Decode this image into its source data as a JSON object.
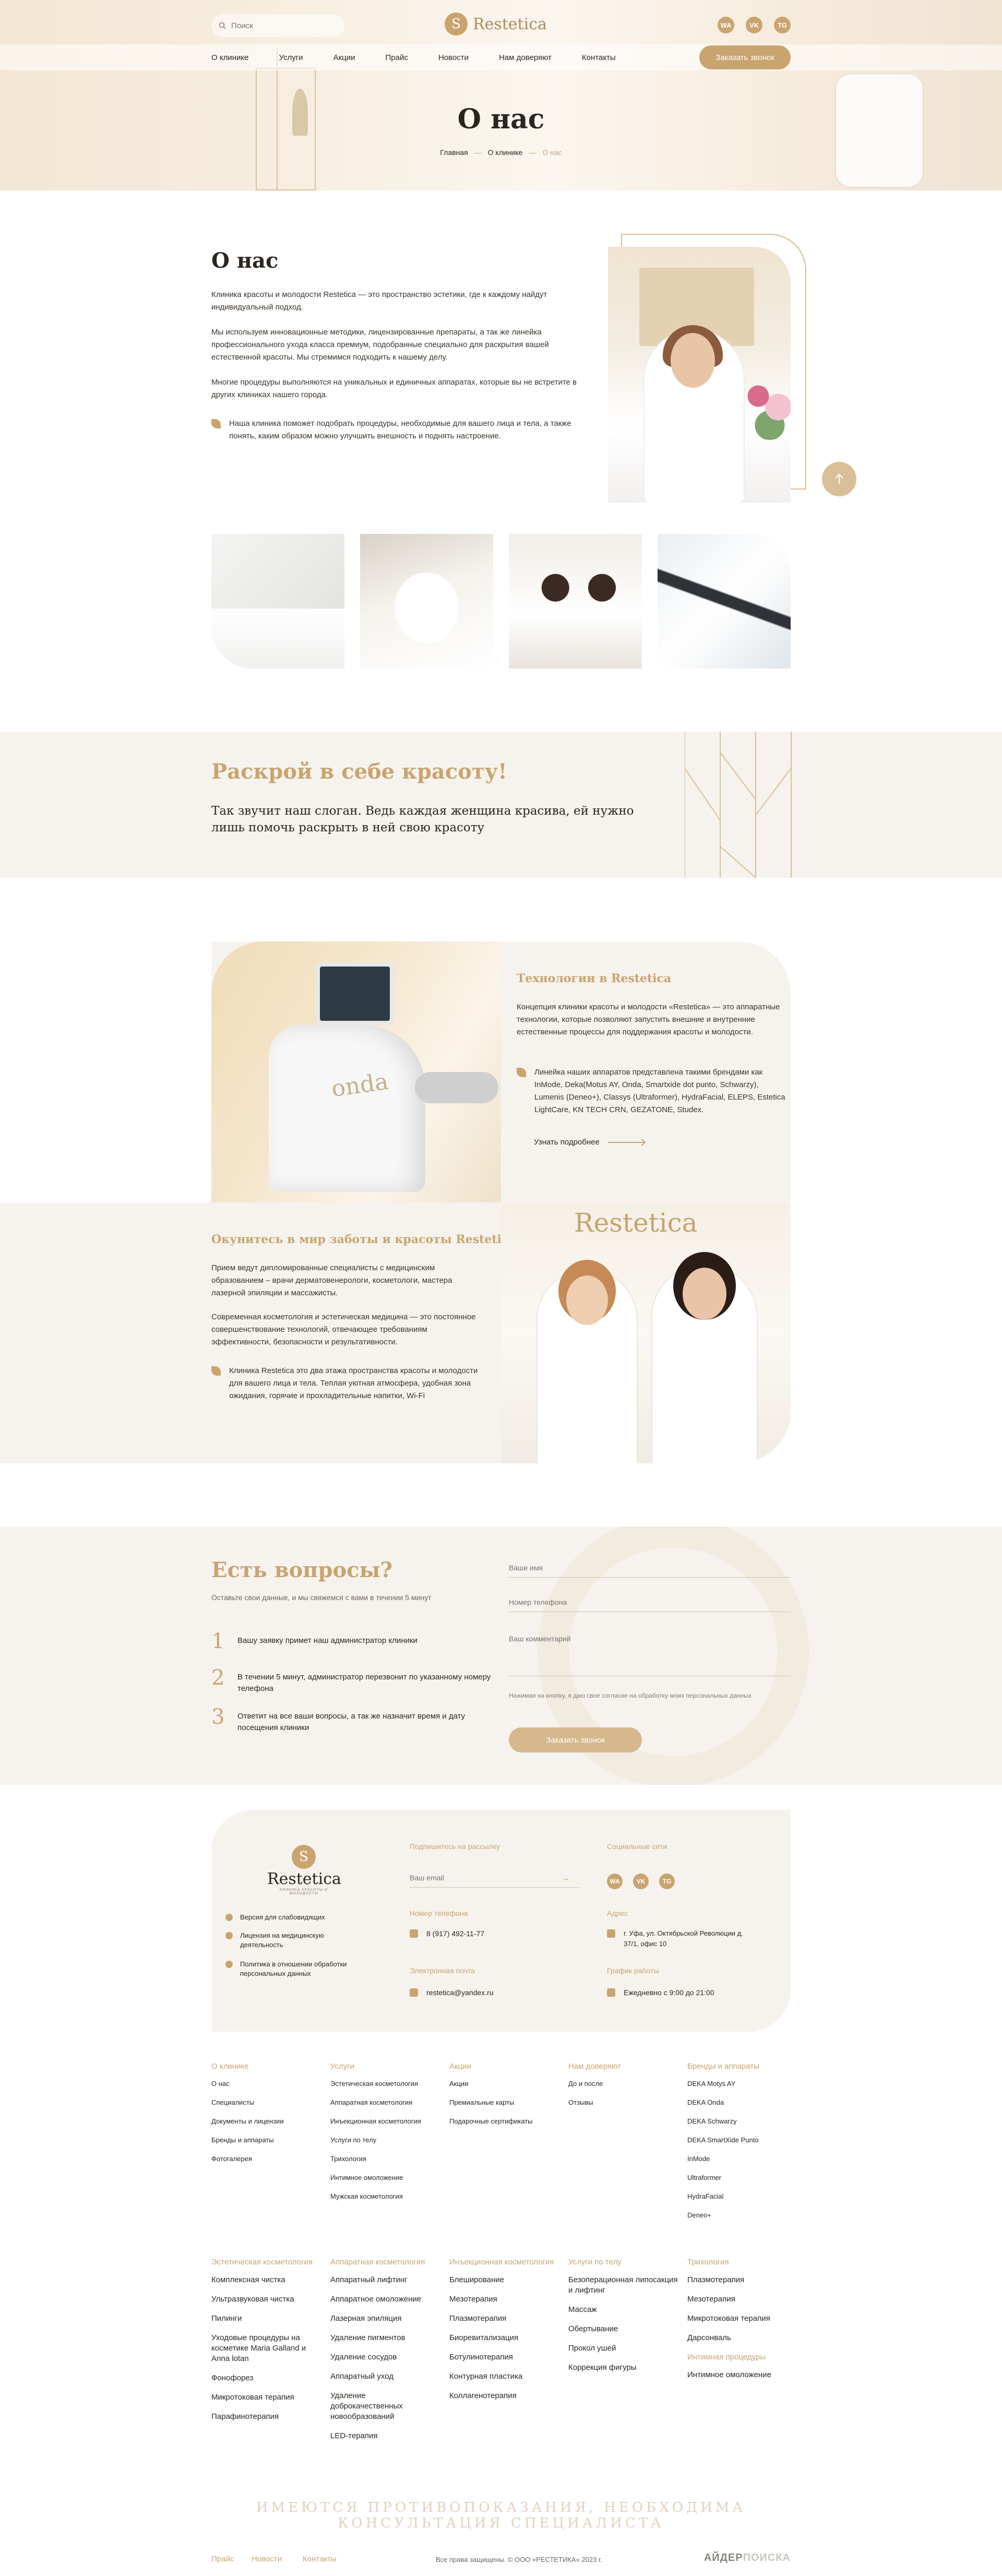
{
  "header": {
    "search_placeholder": "Поиск",
    "logo_text": "Restetica",
    "socials": [
      "WA",
      "VK",
      "TG"
    ],
    "nav": [
      "О клинике",
      "Услуги",
      "Акции",
      "Прайс",
      "Новости",
      "Нам доверяют",
      "Контакты"
    ],
    "call_button": "Заказать звонок"
  },
  "hero": {
    "title": "О нас",
    "breadcrumb": {
      "home": "Главная",
      "clinic": "О клинике",
      "current": "О нас"
    }
  },
  "about": {
    "title": "О нас",
    "p1": "Клиника красоты и молодости Restetica — это пространство эстетики, где к каждому найдут индивидуальный подход.",
    "p2": "Мы используем инновационные методики, лицензированные препараты, а так же линейка профессионального ухода класса премиум, подобранные специально для раскрытия вашей естественной красоты. Мы стремимся подходить к нашему делу.",
    "p3": "Многие процедуры выполняются на уникальных и единичных аппаратах, которые вы не встретите в других клиниках нашего города.",
    "bullet": "Наша клиника поможет подобрать процедуры, необходимые для вашего лица и тела, а также понять, каким образом можно улучшить внешность и поднять настроение."
  },
  "slogan": {
    "title": "Раскрой в себе красоту!",
    "text": "Так звучит наш слоган. Ведь каждая женщина красива, ей нужно лишь помочь раскрыть в ней свою красоту"
  },
  "tech": {
    "title": "Технологии в Restetica",
    "p1": "Концепция клиники красоты и молодости «Restetica» — это аппаратные технологии, которые позволяют запустить внешние и внутренние естественные процессы для поддержания красоты и молодости.",
    "bullet": "Линейка наших аппаратов представлена такими брендами как InMode, Deka(Motus AY, Onda, Smartxide dot punto, Schwarzy), Lumenis (Deneo+), Classys (Ultraformer), HydraFacial, ELEPS, Estetica LightCare, KN TECH CRN, GEZATONE, Studex.",
    "more": "Узнать подробнее"
  },
  "care": {
    "title": "Окунитесь в мир заботы и красоты Restetica!",
    "p1": "Прием ведут дипломированные специалисты с медицинским образованием – врачи дерматовенерологи, косметологи, мастера лазерной эпиляции и массажисты.",
    "p2": "Современная косметология и эстетическая медицина — это постоянное совершенствование технологий, отвечающее требованиям эффективности, безопасности и результативности.",
    "bullet": "Клиника Restetica это два этажа пространства красоты и молодости для вашего лица и тела. Теплая уютная атмосфера, удобная зона ожидания, горячие и прохладительные напитки, Wi-Fi",
    "image_sign": "Restetica"
  },
  "questions": {
    "title": "Есть вопросы?",
    "subtitle": "Оставьте свои данные, и мы свяжемся с вами в течении 5 минут",
    "steps": [
      {
        "n": "1",
        "text": "Вашу заявку примет наш администратор клиники"
      },
      {
        "n": "2",
        "text": "В течении 5 минут, администратор перезвонит по указанному номеру телефона"
      },
      {
        "n": "3",
        "text": "Ответит на все ваши вопросы, а так же назначит время и дату посещения клиники"
      }
    ],
    "name_placeholder": "Ваше имя",
    "phone_placeholder": "Номер телефона",
    "comment_placeholder": "Ваш комментарий",
    "consent": "Нажимая на кнопку, я даю свое согласие на обработку моих персональных данных",
    "button": "Заказать звонок"
  },
  "footer_card": {
    "logo": "Restetica",
    "logo_sub": "КЛИНИКА КРАСОТЫ И МОЛОДОСТИ",
    "links": [
      "Версия для слабовидящих",
      "Лицензия на медицинскую деятельность",
      "Политика в отношении обработки персональных данных"
    ],
    "subscribe_label": "Подпишитесь на рассылку",
    "email_placeholder": "Ваш email",
    "phone_label": "Номер телефона",
    "phone": "8 (917) 492-11-77",
    "mail_label": "Электронная почта",
    "mail": "restetica@yandex.ru",
    "social_label": "Социальные сети",
    "address_label": "Адрес",
    "address": "г. Уфа, ул. Октябрьской Революции д. 37/1, офис 10",
    "hours_label": "График работы",
    "hours": "Ежедневно с 9:00 до 21:00"
  },
  "sitemap": {
    "row1": [
      {
        "head": "О клинике",
        "items": [
          "О нас",
          "Специалисты",
          "Документы и лицензии",
          "Бренды и аппараты",
          "Фотогалерея"
        ]
      },
      {
        "head": "Услуги",
        "items": [
          "Эстетическая косметология",
          "Аппаратная косметология",
          "Инъекционная косметология",
          "Услуги по телу",
          "Трихология",
          "Интимное омоложение",
          "Мужская косметология"
        ]
      },
      {
        "head": "Акции",
        "items": [
          "Акции",
          "Премиальные карты",
          "Подарочные сертификаты"
        ]
      },
      {
        "head": "Нам доверяют",
        "items": [
          "До и после",
          "Отзывы"
        ]
      },
      {
        "head": "Бренды и аппараты",
        "items": [
          "DEKA Motys AY",
          "DEKA Onda",
          "DEKA Schwarzy",
          "DEKA SmartXide Punto",
          "InMode",
          "Ultraformer",
          "HydraFacial",
          "Deneo+"
        ]
      }
    ],
    "row2": [
      {
        "head": "Эстетическая косметология",
        "items": [
          "Комплексная чистка",
          "Ультразвуковая чистка",
          "Пилинги",
          "Уходовые процедуры на косметике Maria Galland и Anna lotan",
          "Фонофорез",
          "Микротоковая терапия",
          "Парафинотерапия"
        ]
      },
      {
        "head": "Аппаратная косметология",
        "items": [
          "Аппаратный лифтинг",
          "Аппаратное омоложение",
          "Лазерная эпиляция",
          "Удаление пигментов",
          "Удаление сосудов",
          "Аппаратный уход",
          "Удаление доброкачественных новообразований",
          "LED-терапия"
        ]
      },
      {
        "head": "Инъекционная косметология",
        "items": [
          "Блеширование",
          "Мезотерапия",
          "Плазмотерапия",
          "Биоревитализация",
          "Ботулинотерапия",
          "Контурная пластика",
          "Коллагенотерапия"
        ]
      },
      {
        "head": "Услуги по телу",
        "items": [
          "Безоперационная липосакция и лифтинг",
          "Массаж",
          "Обертывание",
          "Прокол ушей",
          "Коррекция фигуры"
        ]
      },
      {
        "head": "Трихология",
        "items": [
          "Плазмотерапия",
          "Мезотерапия",
          "Микротоковая терапия",
          "Дарсонваль"
        ],
        "head2": "Интимная процедуры",
        "items2": [
          "Интимное омоложение"
        ]
      }
    ]
  },
  "bottom": {
    "disclaimer": "ИМЕЮТСЯ ПРОТИВОПОКАЗАНИЯ, НЕОБХОДИМА КОНСУЛЬТАЦИЯ СПЕЦИАЛИСТА",
    "links": [
      "Прайс",
      "Новости",
      "Контакты"
    ],
    "copyright": "Все права защищены. © ООО «РЕСТЕТИКА» 2023 г.",
    "dev_a": "АЙДЕР",
    "dev_b": "ПОИСКА"
  }
}
